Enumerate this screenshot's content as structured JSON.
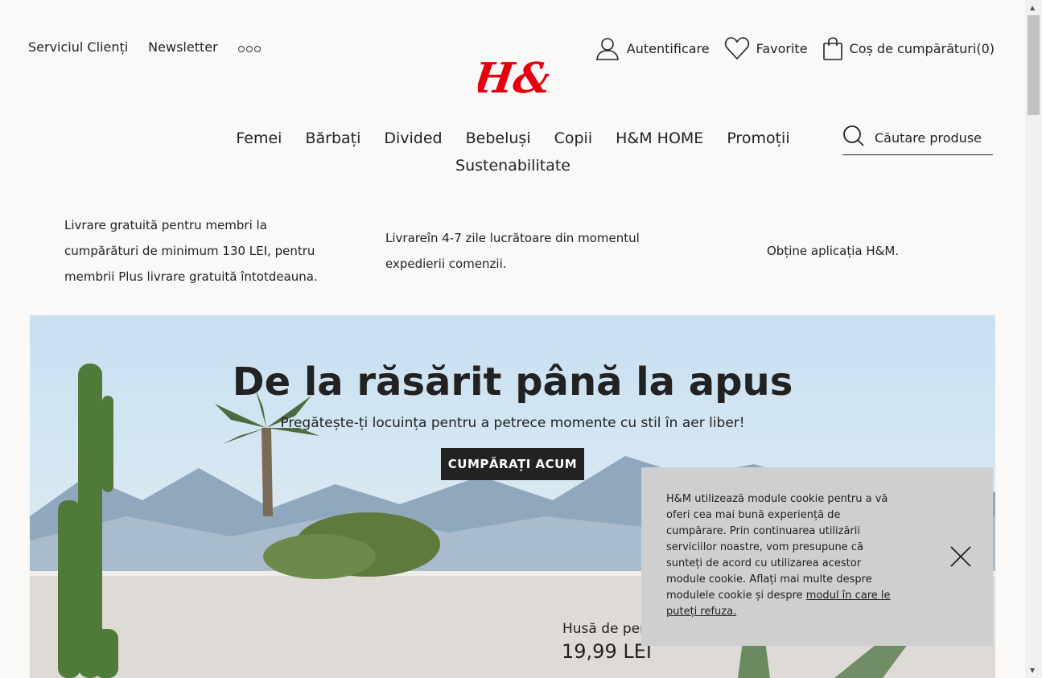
{
  "header": {
    "customer_service": "Serviciul Clienți",
    "newsletter": "Newsletter",
    "login": "Autentificare",
    "favorites": "Favorite",
    "cart_label": "Coș de cumpărături",
    "cart_count": "(0)",
    "logo": "H&M",
    "brand_color": "#e50010"
  },
  "nav": {
    "items": [
      "Femei",
      "Bărbați",
      "Divided",
      "Bebeluși",
      "Copii",
      "H&M HOME",
      "Promoții",
      "Sustenabilitate"
    ]
  },
  "search": {
    "placeholder": "Căutare produse"
  },
  "info": {
    "delivery_free": "Livrare gratuită pentru membri la cumpărături de minimum 130 LEI, pentru membrii Plus livrare gratuită întotdeauna.",
    "delivery_time": "Livrareîn 4-7 zile lucrătoare din momentul expedierii comenzii.",
    "app": "Obține aplicația H&M."
  },
  "hero": {
    "title": "De la răsărit până la apus",
    "subtitle": "Pregătește-ți locuința pentru a petrece momente cu stil în aer liber!",
    "cta": "CUMPĂRAȚI ACUM",
    "product_name": "Husă de per",
    "product_price": "19,99 LEI"
  },
  "cookie": {
    "text": "H&M utilizează module cookie pentru a vă oferi cea mai bună experiență de cumpărare. Prin continuarea utilizării serviciilor noastre, vom presupune că sunteți de acord cu utilizarea acestor module cookie. Aflați mai multe despre modulele cookie și despre ",
    "link": "modul în care le puteți refuza."
  }
}
